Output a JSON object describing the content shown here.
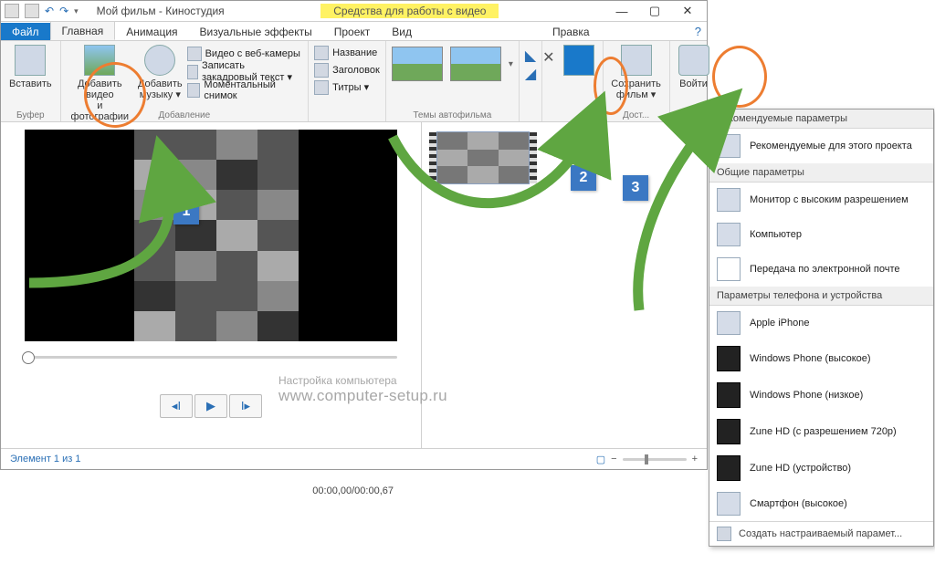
{
  "titlebar": {
    "title": "Мой фильм - Киностудия",
    "context_tab": "Средства для работы с видео"
  },
  "tabs": {
    "file": "Файл",
    "home": "Главная",
    "animation": "Анимация",
    "effects": "Визуальные эффекты",
    "project": "Проект",
    "view": "Вид",
    "edit": "Правка"
  },
  "ribbon": {
    "paste": "Вставить",
    "buffer_group": "Буфер",
    "add_video": "Добавить видео\nи фотографии",
    "add_music": "Добавить\nмузыку ▾",
    "add_group": "Добавление",
    "webcam": "Видео с веб-камеры",
    "narration": "Записать закадровый текст ▾",
    "snapshot": "Моментальный снимок",
    "title_btn": "Название",
    "caption_btn": "Заголовок",
    "credits_btn": "Титры ▾",
    "themes_group": "Темы автофильма",
    "save_movie": "Сохранить\nфильм ▾",
    "signin": "Войти",
    "share_group": "Дост..."
  },
  "timeline": {
    "timecode": "00:00,00/00:00,67",
    "status": "Элемент 1 из 1"
  },
  "dropdown": {
    "h1": "Рекомендуемые параметры",
    "i1": "Рекомендуемые для этого проекта",
    "h2": "Общие параметры",
    "i2": "Монитор с высоким разрешением",
    "i3": "Компьютер",
    "i4": "Передача по электронной почте",
    "h3": "Параметры телефона и устройства",
    "i5": "Apple iPhone",
    "i6": "Windows Phone (высокое)",
    "i7": "Windows Phone (низкое)",
    "i8": "Zune HD (с разрешением 720p)",
    "i9": "Zune HD (устройство)",
    "i10": "Смартфон (высокое)",
    "custom": "Создать настраиваемый парамет..."
  },
  "watermark": {
    "l1": "Настройка компьютера",
    "l2": "www.computer-setup.ru"
  },
  "markers": {
    "m1": "1",
    "m2": "2",
    "m3": "3"
  }
}
